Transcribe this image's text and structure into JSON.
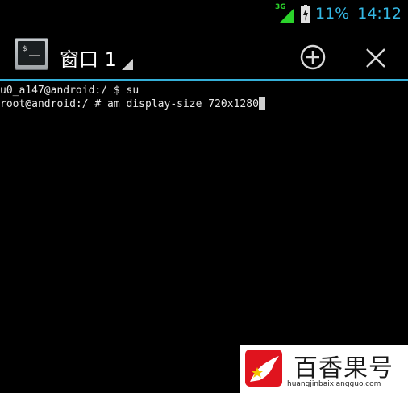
{
  "status_bar": {
    "network_type": "3G",
    "battery_percent": "11%",
    "clock": "14:12",
    "accent_color": "#35b9e6"
  },
  "action_bar": {
    "window_title": "窗口 1",
    "app_icon": "terminal-app-icon",
    "add_icon": "add-circle-icon",
    "close_icon": "close-icon",
    "divider_color": "#35b0d9"
  },
  "terminal": {
    "lines": [
      "u0_a147@android:/ $ su",
      "root@android:/ # am display-size 720x1280"
    ],
    "background": "#000000"
  },
  "watermark": {
    "name": "百香果号",
    "url": "huangjinbaixiangguo.com"
  }
}
